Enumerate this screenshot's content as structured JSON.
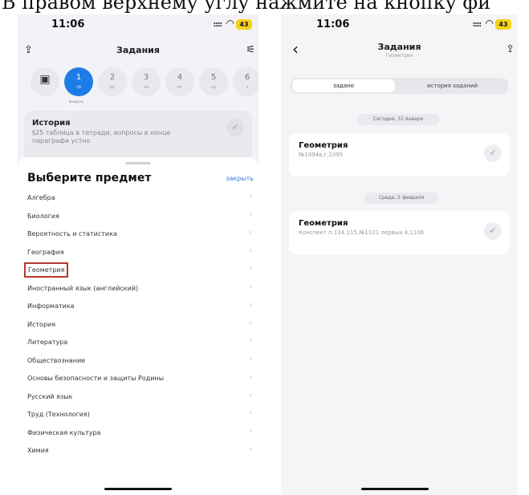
{
  "caption": "В правом верхнему углу нажмите на кнопку фи",
  "left_screen": {
    "status": {
      "time": "11:06",
      "signal": "::::",
      "battery": "43"
    },
    "header": {
      "title": "Задания",
      "share_icon": "share-icon",
      "filter_icon": "sliders-icon"
    },
    "days": [
      {
        "num": "1",
        "wd": "сб"
      },
      {
        "num": "2",
        "wd": "вс"
      },
      {
        "num": "3",
        "wd": "пн"
      },
      {
        "num": "4",
        "wd": "вт"
      },
      {
        "num": "5",
        "wd": "ср"
      },
      {
        "num": "6",
        "wd": "ч"
      }
    ],
    "month_label": "февраль",
    "history_card": {
      "title": "История",
      "desc": "§25 таблица в тетради, вопросы в конце параграфа устно"
    },
    "sheet": {
      "title": "Выберите предмет",
      "close": "закрыть",
      "subjects": [
        "Алгебра",
        "Биология",
        "Вероятность и статистика",
        "География",
        "Геометрия",
        "Иностранный язык (английский)",
        "Информатика",
        "История",
        "Литература",
        "Обществознание",
        "Основы безопасности и защиты Родины",
        "Русский язык",
        "Труд (Технология)",
        "Физическая культура",
        "Химия"
      ],
      "highlighted_index": 4
    }
  },
  "right_screen": {
    "status": {
      "time": "11:06",
      "signal": "::::",
      "battery": "43"
    },
    "header": {
      "title": "Задания",
      "subtitle": "Геометрия"
    },
    "tabs": {
      "assigned": "задано",
      "history": "история заданий"
    },
    "groups": [
      {
        "date": "Сегодня, 31 января",
        "title": "Геометрия",
        "desc": "№1094в,г,1095"
      },
      {
        "date": "Среда, 5 февраля",
        "title": "Геометрия",
        "desc": "Конспект п.114,115,№1101 первых 4,1106"
      }
    ]
  },
  "colors": {
    "accent": "#1e7ce6",
    "highlight_border": "#b23a2e",
    "link": "#3a7bd5",
    "battery": "#f7d31b"
  }
}
